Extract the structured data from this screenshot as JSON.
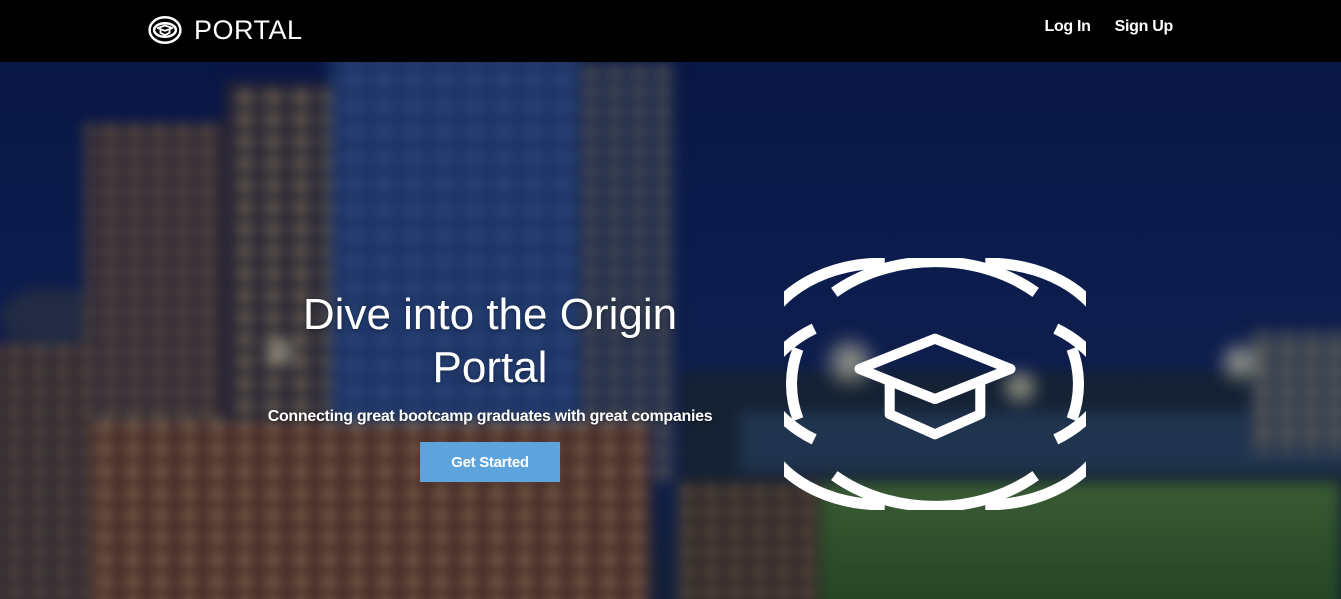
{
  "navbar": {
    "brand": {
      "logo_icon": "origin-logo-icon",
      "name": "PORTAL"
    },
    "links": [
      {
        "label": "Log In"
      },
      {
        "label": "Sign Up"
      }
    ]
  },
  "hero": {
    "title_line1": "Dive into the Origin",
    "title_line2": "Portal",
    "subtitle": "Connecting great bootcamp graduates with great companies",
    "cta_label": "Get Started",
    "logo_icon": "origin-logo-icon",
    "background": "city-night-skyline"
  },
  "colors": {
    "navbar_bg": "#000000",
    "cta_bg": "#5da3dc",
    "text": "#ffffff"
  }
}
